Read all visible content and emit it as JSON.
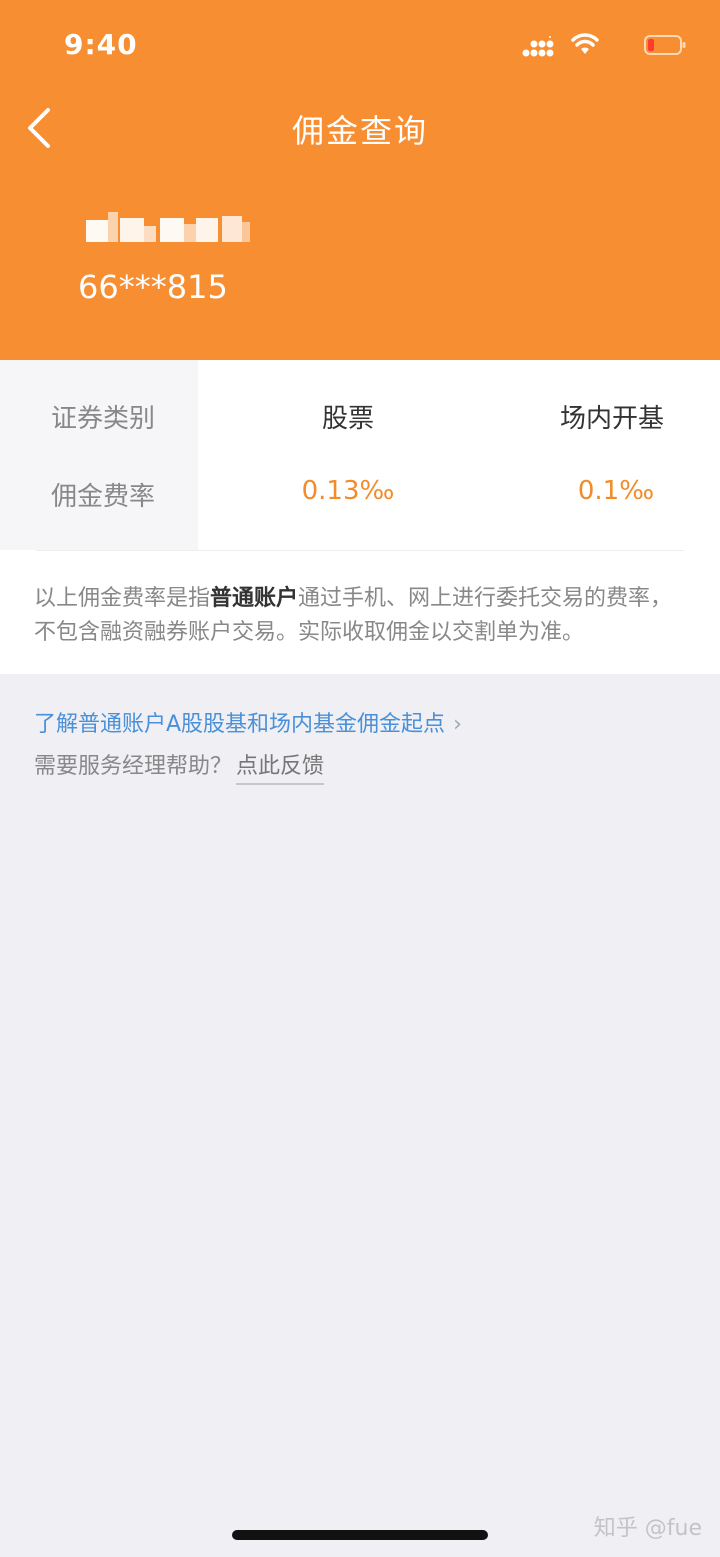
{
  "status_bar": {
    "time": "9:40"
  },
  "header": {
    "title": "佣金查询",
    "account_number": "66***815"
  },
  "commission_table": {
    "row_labels": [
      "证券类别",
      "佣金费率"
    ],
    "columns": [
      {
        "name": "股票",
        "rate": "0.13‰"
      },
      {
        "name": "场内开基",
        "rate": "0.1‰"
      }
    ]
  },
  "note": {
    "part1": "以上佣金费率是指",
    "bold": "普通账户",
    "part2": "通过手机、网上进行委托交易的费率，",
    "line2": "不包含融资融券账户交易。实际收取佣金以交割单为准。"
  },
  "links": {
    "learn_more": "了解普通账户A股股基和场内基金佣金起点",
    "help_prompt": "需要服务经理帮助？",
    "feedback": "点此反馈"
  },
  "watermark": "知乎 @fue",
  "colors": {
    "header_bg": "#f78e31",
    "rate": "#f28c2a",
    "link": "#4a90d9"
  }
}
